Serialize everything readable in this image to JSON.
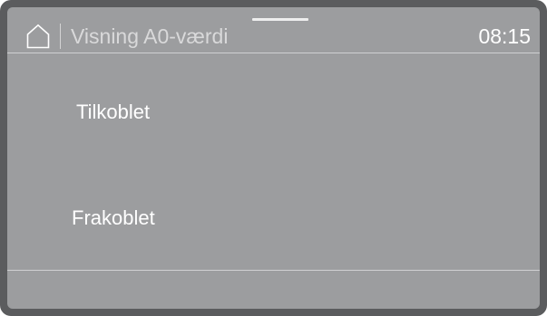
{
  "header": {
    "home_icon": "home-icon",
    "title": "Visning A0-værdi",
    "time": "08:15"
  },
  "options": [
    {
      "label": "Tilkoblet"
    },
    {
      "label": "Frakoblet"
    }
  ],
  "colors": {
    "bezel": "#5b5c5e",
    "screen": "#9c9d9f",
    "text": "#ffffff",
    "title_text": "#d9d9da"
  }
}
